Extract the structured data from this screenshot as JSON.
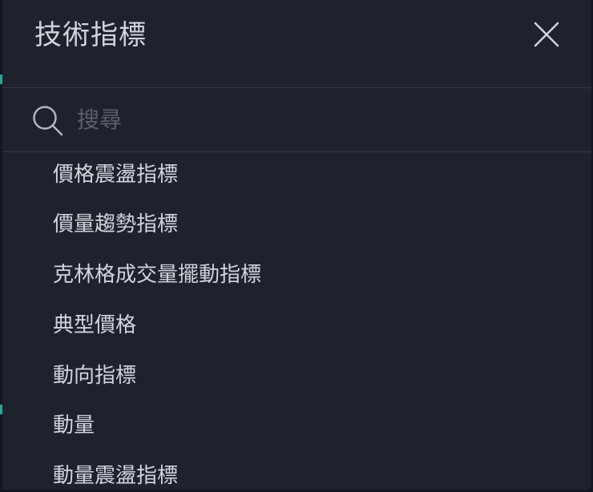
{
  "dialog": {
    "title": "技術指標",
    "close_icon": "close-icon"
  },
  "search": {
    "placeholder": "搜尋",
    "value": "",
    "icon": "search-icon"
  },
  "indicators": [
    {
      "label": "價格震盪指標"
    },
    {
      "label": "價量趨勢指標"
    },
    {
      "label": "克林格成交量擺動指標"
    },
    {
      "label": "典型價格"
    },
    {
      "label": "動向指標"
    },
    {
      "label": "動量"
    },
    {
      "label": "動量震盪指標"
    }
  ],
  "colors": {
    "background": "#1e222d",
    "text": "#d1d4dc",
    "placeholder": "#5d606b",
    "divider": "#363a45",
    "accent": "#26a69a"
  }
}
